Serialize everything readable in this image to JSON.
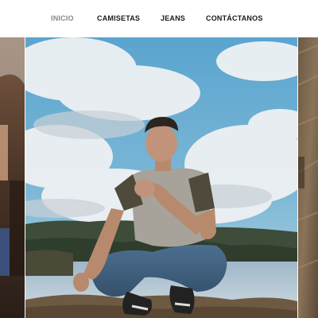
{
  "nav": {
    "items": [
      {
        "label": "INICIO",
        "active": true
      },
      {
        "label": "CAMISETAS",
        "active": false
      },
      {
        "label": "JEANS",
        "active": false
      },
      {
        "label": "CONTÁCTANOS",
        "active": false
      }
    ],
    "active_color": "#888888",
    "text_color": "#1a1a1a"
  },
  "hero": {
    "slides": [
      "previous-slide-photo",
      "model-crouching-photo",
      "next-slide-photo"
    ],
    "active_slide_index": 1
  }
}
